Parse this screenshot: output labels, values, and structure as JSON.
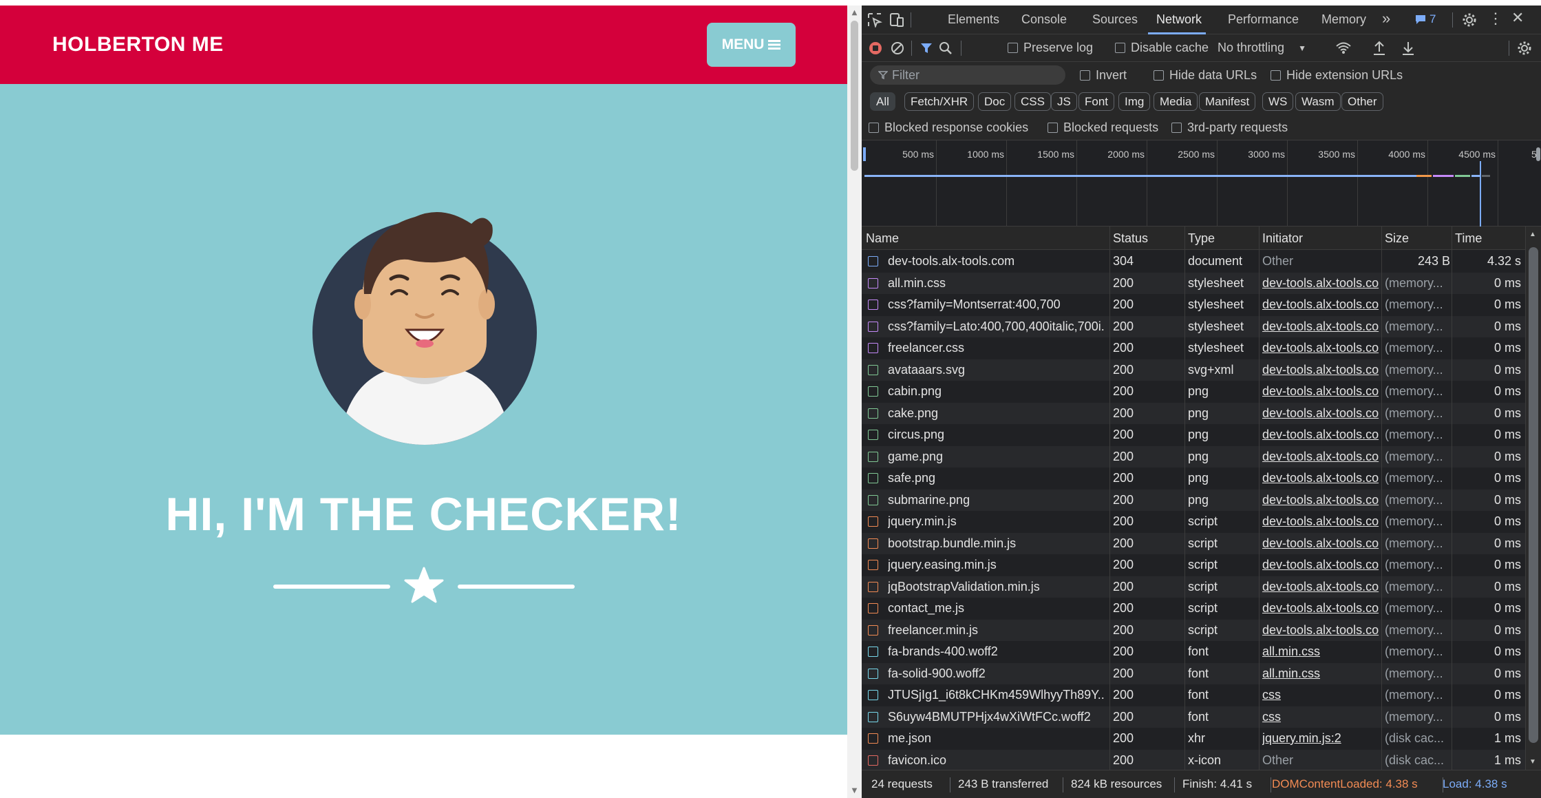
{
  "page": {
    "brand": "HOLBERTON ME",
    "menu_label": "MENU",
    "hero_title": "HI, I'M THE CHECKER!"
  },
  "devtools": {
    "tabs": [
      "Elements",
      "Console",
      "Sources",
      "Network",
      "Performance",
      "Memory"
    ],
    "active_tab": "Network",
    "issues_count": "7",
    "toolbar": {
      "preserve_log": "Preserve log",
      "disable_cache": "Disable cache",
      "throttling": "No throttling"
    },
    "filter": {
      "placeholder": "Filter",
      "invert": "Invert",
      "hide_data_urls": "Hide data URLs",
      "hide_extension_urls": "Hide extension URLs"
    },
    "type_filters": [
      "All",
      "Fetch/XHR",
      "Doc",
      "CSS",
      "JS",
      "Font",
      "Img",
      "Media",
      "Manifest",
      "WS",
      "Wasm",
      "Other"
    ],
    "blocked": {
      "cookies": "Blocked response cookies",
      "requests": "Blocked requests",
      "third_party": "3rd-party requests"
    },
    "timeline_ticks": [
      "500 ms",
      "1000 ms",
      "1500 ms",
      "2000 ms",
      "2500 ms",
      "3000 ms",
      "3500 ms",
      "4000 ms",
      "4500 ms",
      "5"
    ],
    "columns": [
      "Name",
      "Status",
      "Type",
      "Initiator",
      "Size",
      "Time"
    ],
    "rows": [
      {
        "name": "dev-tools.alx-tools.com",
        "status": "304",
        "type": "document",
        "initiator": "Other",
        "size": "243 B",
        "time": "4.32 s",
        "kind": "doc"
      },
      {
        "name": "all.min.css",
        "status": "200",
        "type": "stylesheet",
        "initiator": "dev-tools.alx-tools.co",
        "size": "(memory...",
        "time": "0 ms",
        "kind": "css"
      },
      {
        "name": "css?family=Montserrat:400,700",
        "status": "200",
        "type": "stylesheet",
        "initiator": "dev-tools.alx-tools.co",
        "size": "(memory...",
        "time": "0 ms",
        "kind": "css"
      },
      {
        "name": "css?family=Lato:400,700,400italic,700i...",
        "status": "200",
        "type": "stylesheet",
        "initiator": "dev-tools.alx-tools.co",
        "size": "(memory...",
        "time": "0 ms",
        "kind": "css"
      },
      {
        "name": "freelancer.css",
        "status": "200",
        "type": "stylesheet",
        "initiator": "dev-tools.alx-tools.co",
        "size": "(memory...",
        "time": "0 ms",
        "kind": "css"
      },
      {
        "name": "avataaars.svg",
        "status": "200",
        "type": "svg+xml",
        "initiator": "dev-tools.alx-tools.co",
        "size": "(memory...",
        "time": "0 ms",
        "kind": "img"
      },
      {
        "name": "cabin.png",
        "status": "200",
        "type": "png",
        "initiator": "dev-tools.alx-tools.co",
        "size": "(memory...",
        "time": "0 ms",
        "kind": "img"
      },
      {
        "name": "cake.png",
        "status": "200",
        "type": "png",
        "initiator": "dev-tools.alx-tools.co",
        "size": "(memory...",
        "time": "0 ms",
        "kind": "img"
      },
      {
        "name": "circus.png",
        "status": "200",
        "type": "png",
        "initiator": "dev-tools.alx-tools.co",
        "size": "(memory...",
        "time": "0 ms",
        "kind": "img"
      },
      {
        "name": "game.png",
        "status": "200",
        "type": "png",
        "initiator": "dev-tools.alx-tools.co",
        "size": "(memory...",
        "time": "0 ms",
        "kind": "img"
      },
      {
        "name": "safe.png",
        "status": "200",
        "type": "png",
        "initiator": "dev-tools.alx-tools.co",
        "size": "(memory...",
        "time": "0 ms",
        "kind": "img"
      },
      {
        "name": "submarine.png",
        "status": "200",
        "type": "png",
        "initiator": "dev-tools.alx-tools.co",
        "size": "(memory...",
        "time": "0 ms",
        "kind": "img"
      },
      {
        "name": "jquery.min.js",
        "status": "200",
        "type": "script",
        "initiator": "dev-tools.alx-tools.co",
        "size": "(memory...",
        "time": "0 ms",
        "kind": "js"
      },
      {
        "name": "bootstrap.bundle.min.js",
        "status": "200",
        "type": "script",
        "initiator": "dev-tools.alx-tools.co",
        "size": "(memory...",
        "time": "0 ms",
        "kind": "js"
      },
      {
        "name": "jquery.easing.min.js",
        "status": "200",
        "type": "script",
        "initiator": "dev-tools.alx-tools.co",
        "size": "(memory...",
        "time": "0 ms",
        "kind": "js"
      },
      {
        "name": "jqBootstrapValidation.min.js",
        "status": "200",
        "type": "script",
        "initiator": "dev-tools.alx-tools.co",
        "size": "(memory...",
        "time": "0 ms",
        "kind": "js"
      },
      {
        "name": "contact_me.js",
        "status": "200",
        "type": "script",
        "initiator": "dev-tools.alx-tools.co",
        "size": "(memory...",
        "time": "0 ms",
        "kind": "js"
      },
      {
        "name": "freelancer.min.js",
        "status": "200",
        "type": "script",
        "initiator": "dev-tools.alx-tools.co",
        "size": "(memory...",
        "time": "0 ms",
        "kind": "js"
      },
      {
        "name": "fa-brands-400.woff2",
        "status": "200",
        "type": "font",
        "initiator": "all.min.css",
        "size": "(memory...",
        "time": "0 ms",
        "kind": "font"
      },
      {
        "name": "fa-solid-900.woff2",
        "status": "200",
        "type": "font",
        "initiator": "all.min.css",
        "size": "(memory...",
        "time": "0 ms",
        "kind": "font"
      },
      {
        "name": "JTUSjIg1_i6t8kCHKm459WlhyyTh89Y....",
        "status": "200",
        "type": "font",
        "initiator": "css",
        "size": "(memory...",
        "time": "0 ms",
        "kind": "font"
      },
      {
        "name": "S6uyw4BMUTPHjx4wXiWtFCc.woff2",
        "status": "200",
        "type": "font",
        "initiator": "css",
        "size": "(memory...",
        "time": "0 ms",
        "kind": "font"
      },
      {
        "name": "me.json",
        "status": "200",
        "type": "xhr",
        "initiator": "jquery.min.js:2",
        "size": "(disk cac...",
        "time": "1 ms",
        "kind": "xhr"
      },
      {
        "name": "favicon.ico",
        "status": "200",
        "type": "x-icon",
        "initiator": "Other",
        "size": "(disk cac...",
        "time": "1 ms",
        "kind": "other"
      }
    ],
    "status_bar": {
      "requests": "24 requests",
      "transferred": "243 B transferred",
      "resources": "824 kB resources",
      "finish": "Finish: 4.41 s",
      "dom_content_loaded": "DOMContentLoaded: 4.38 s",
      "load": "Load: 4.38 s"
    },
    "colors": {
      "accent": "#7cacf8",
      "dcl": "#f28b54",
      "load": "#7cacf8",
      "navbar": "#d4003b",
      "hero": "#89cbd2"
    }
  }
}
